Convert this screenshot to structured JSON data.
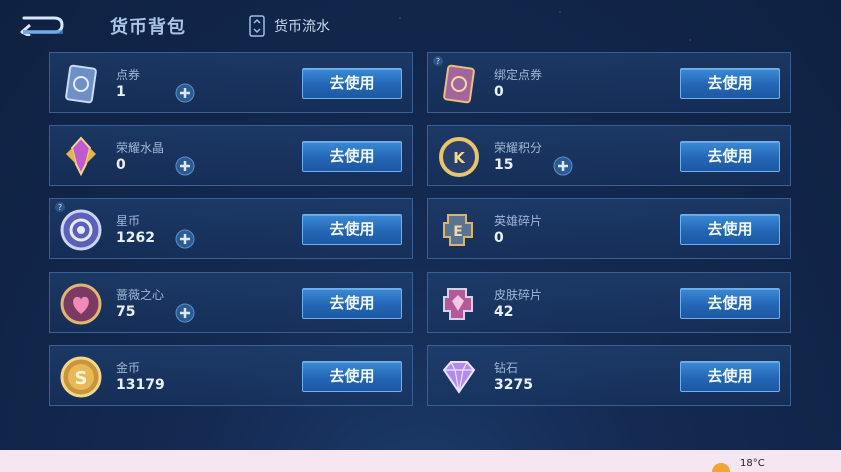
{
  "header": {
    "title": "货币背包",
    "flow_label": "货币流水"
  },
  "currencies": [
    {
      "name": "点券",
      "count": "1",
      "button": "去使用",
      "has_plus": true
    },
    {
      "name": "绑定点券",
      "count": "0",
      "button": "去使用",
      "has_plus": false
    },
    {
      "name": "荣耀水晶",
      "count": "0",
      "button": "去使用",
      "has_plus": true
    },
    {
      "name": "荣耀积分",
      "count": "15",
      "button": "去使用",
      "has_plus": true
    },
    {
      "name": "星币",
      "count": "1262",
      "button": "去使用",
      "has_plus": true
    },
    {
      "name": "英雄碎片",
      "count": "0",
      "button": "去使用",
      "has_plus": false
    },
    {
      "name": "蔷薇之心",
      "count": "75",
      "button": "去使用",
      "has_plus": true
    },
    {
      "name": "皮肤碎片",
      "count": "42",
      "button": "去使用",
      "has_plus": false
    },
    {
      "name": "金币",
      "count": "13179",
      "button": "去使用",
      "has_plus": false
    },
    {
      "name": "钻石",
      "count": "3275",
      "button": "去使用",
      "has_plus": false
    }
  ],
  "taskbar": {
    "temperature": "18°C"
  },
  "colors": {
    "accent": "#2a6fc0",
    "panel_border": "#3a5f92",
    "background": "#142a52"
  },
  "icons": [
    "back-arrow-icon",
    "card-flow-icon",
    "coupon-icon",
    "bound-coupon-icon",
    "glory-crystal-icon",
    "glory-points-icon",
    "star-coin-icon",
    "hero-fragment-icon",
    "rose-heart-icon",
    "skin-fragment-icon",
    "gold-coin-icon",
    "diamond-icon",
    "plus-icon",
    "weather-sun-icon"
  ]
}
